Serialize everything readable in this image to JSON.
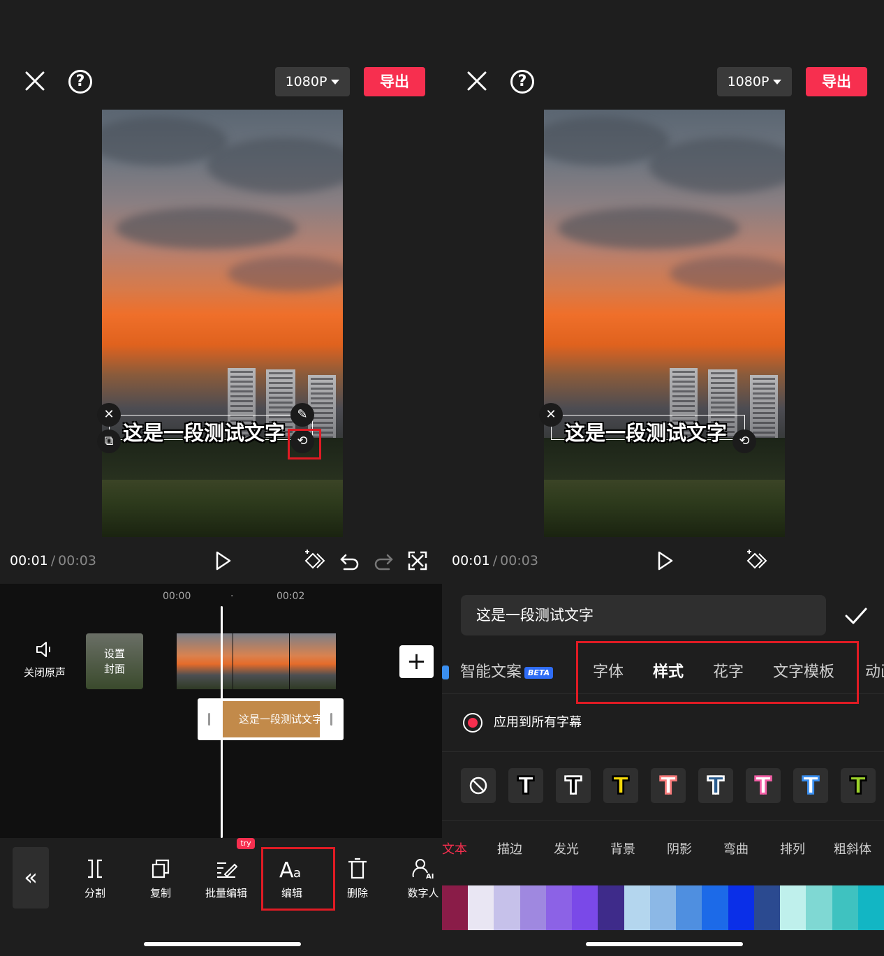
{
  "left": {
    "resolution": "1080P",
    "export": "导出",
    "subtitle": "这是一段测试文字",
    "time_current": "00:01",
    "time_sep": "/",
    "time_total": "00:03",
    "ticks": [
      "00:00",
      "·",
      "00:02"
    ],
    "mute_label": "关闭原声",
    "cover_line1": "设置",
    "cover_line2": "封面",
    "text_clip": "这是一段测试文字",
    "add": "+",
    "try_badge": "try",
    "tools": [
      "分割",
      "复制",
      "批量编辑",
      "编辑",
      "删除",
      "数字人"
    ],
    "back": "«"
  },
  "right": {
    "resolution": "1080P",
    "export": "导出",
    "subtitle": "这是一段测试文字",
    "time_current": "00:01",
    "time_sep": "/",
    "time_total": "00:03",
    "text_input_value": "这是一段测试文字",
    "tabs": [
      "智能文案",
      "字体",
      "样式",
      "花字",
      "文字模板",
      "动画"
    ],
    "active_tab": "样式",
    "beta": "BETA",
    "apply_all": "应用到所有字幕",
    "presets": [
      {
        "fill": "#ffffff",
        "stroke": "#000000"
      },
      {
        "fill": "#000000",
        "stroke": "#ffffff"
      },
      {
        "fill": "#f5d90a",
        "stroke": "#000000"
      },
      {
        "fill": "#ffffff",
        "stroke": "#f57a7a"
      },
      {
        "fill": "#2b5d8f",
        "stroke": "#ffffff"
      },
      {
        "fill": "#ffffff",
        "stroke": "#f25fa6"
      },
      {
        "fill": "#ffffff",
        "stroke": "#3a8ff0"
      },
      {
        "fill": "#9bd12a",
        "stroke": "#000000"
      }
    ],
    "subtabs": [
      "文本",
      "描边",
      "发光",
      "背景",
      "阴影",
      "弯曲",
      "排列",
      "粗斜体"
    ],
    "active_subtab": "文本",
    "swatches": [
      "#8a1c48",
      "#e9e6f3",
      "#c6c1ea",
      "#9f88e0",
      "#8c62e6",
      "#7a49e8",
      "#3e2b8a",
      "#b4d6ee",
      "#8cb8e6",
      "#4f8fe0",
      "#1c6ae8",
      "#0a2fe8",
      "#2b4a90",
      "#bff0ec",
      "#7fd8d3",
      "#3fc2c0",
      "#12b6c4"
    ]
  },
  "colors": {
    "accent": "#f72f4f",
    "highlight_frame": "#e01b24",
    "beta_blue": "#2f6df6",
    "clip_brown": "#c28a4a"
  }
}
